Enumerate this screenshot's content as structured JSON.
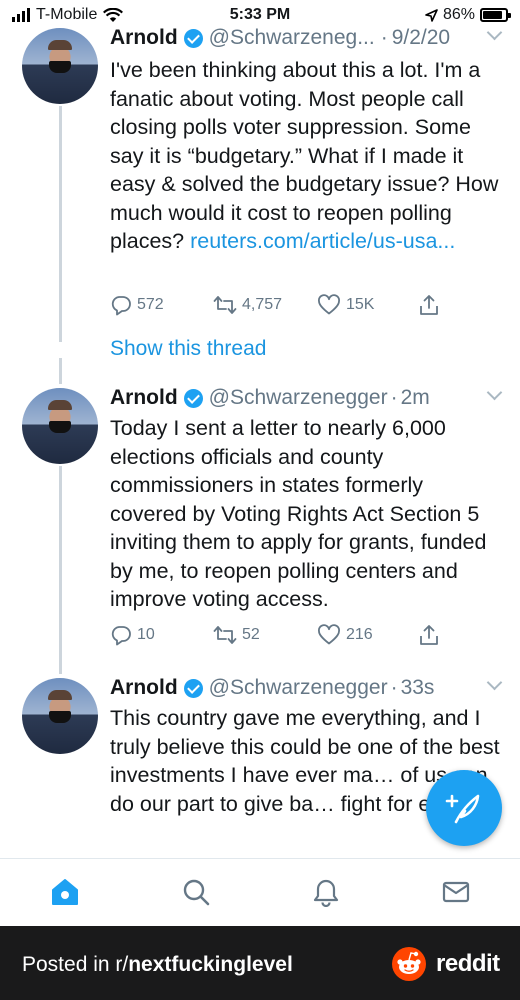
{
  "status_bar": {
    "carrier": "T-Mobile",
    "time": "5:33 PM",
    "battery": "86%",
    "battery_level": 0.86,
    "icons": [
      "signal-icon",
      "wifi-icon",
      "location-icon",
      "battery-icon"
    ]
  },
  "tweets": [
    {
      "name": "Arnold",
      "handle": "@Schwarzeneg...",
      "separator": "·",
      "time": "9/2/20",
      "text": "I've been thinking about this a lot. I'm a fanatic about voting. Most people call closing polls voter suppression. Some say it is “budgetary.” What if I made it easy & solved the budgetary issue? How much would it cost to reopen polling places?",
      "link": "reuters.com/article/us-usa...",
      "replies": "572",
      "retweets": "4,757",
      "likes": "15K"
    },
    {
      "name": "Arnold",
      "handle": "@Schwarzenegger",
      "separator": "·",
      "time": "2m",
      "text": "Today I sent a letter to nearly 6,000 elections officials and county commissioners in states formerly covered by Voting Rights Act Section 5 inviting them to apply for grants, funded by me, to reopen polling centers and improve voting access.",
      "replies": "10",
      "retweets": "52",
      "likes": "216"
    },
    {
      "name": "Arnold",
      "handle": "@Schwarzenegger",
      "separator": "·",
      "time": "33s",
      "text": "This country gave me everything, and I truly believe this could be one of the best investments I have ever ma… of us can do our part to give ba… fight for equality."
    }
  ],
  "show_thread": "Show this thread",
  "footer": {
    "posted_in": "Posted in r/",
    "subreddit": "nextfuckinglevel",
    "brand": "reddit"
  },
  "colors": {
    "accent": "#1da1f2",
    "link": "#1b95e0",
    "muted": "#657786",
    "reddit": "#ff4500"
  }
}
